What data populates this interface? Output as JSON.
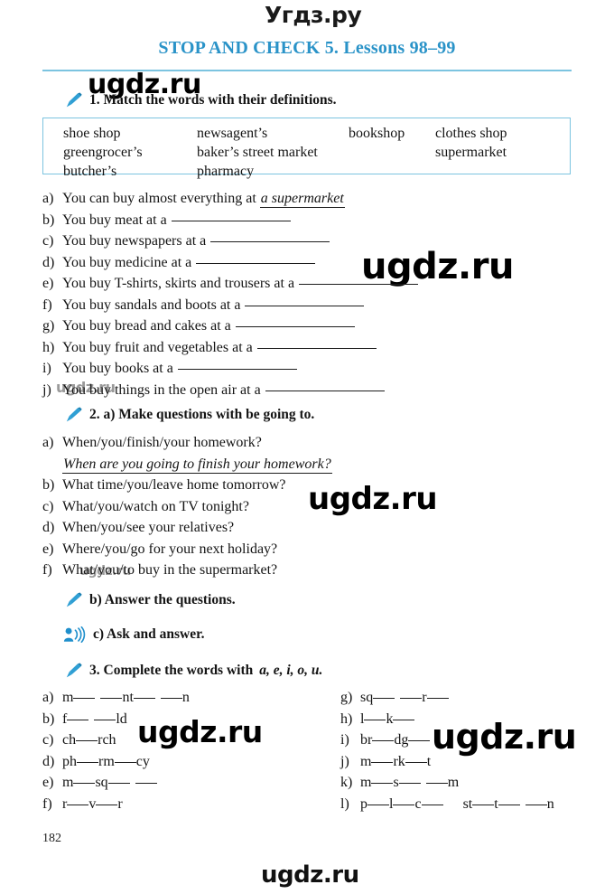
{
  "page": {
    "title": "STOP AND CHECK 5. Lessons 98–99",
    "number": "182",
    "accent_color": "#2a93c8",
    "rule_color": "#7cc4e0"
  },
  "watermarks": {
    "top": "Угдз.ру",
    "brand": "ugdz.ru"
  },
  "exercise1": {
    "heading": "1. Match the words with their definitions.",
    "icon": "pen-icon",
    "wordbank": [
      [
        "shoe shop",
        "newsagent’s",
        "bookshop",
        "clothes shop"
      ],
      [
        "greengrocer’s",
        "baker’s street market",
        "",
        "supermarket"
      ],
      [
        "butcher’s",
        "pharmacy",
        "",
        ""
      ]
    ],
    "items": [
      {
        "marker": "a)",
        "text": "You can buy almost everything at",
        "answer": "a supermarket",
        "blank": 0
      },
      {
        "marker": "b)",
        "text": "You buy meat at a",
        "answer": "",
        "blank": 132
      },
      {
        "marker": "c)",
        "text": "You buy newspapers at a",
        "answer": "",
        "blank": 132
      },
      {
        "marker": "d)",
        "text": "You buy medicine at a",
        "answer": "",
        "blank": 132
      },
      {
        "marker": "e)",
        "text": "You buy T-shirts, skirts and trousers at a",
        "answer": "",
        "blank": 132
      },
      {
        "marker": "f)",
        "text": "You buy sandals and boots at a",
        "answer": "",
        "blank": 132
      },
      {
        "marker": "g)",
        "text": "You buy bread and cakes at a",
        "answer": "",
        "blank": 132
      },
      {
        "marker": "h)",
        "text": "You buy fruit and vegetables at a",
        "answer": "",
        "blank": 132
      },
      {
        "marker": "i)",
        "text": "You buy books at a",
        "answer": "",
        "blank": 132
      },
      {
        "marker": "j)",
        "text": "You buy things in the open air at a",
        "answer": "",
        "blank": 132
      }
    ]
  },
  "exercise2": {
    "heading_a": "2. a) Make questions with be going to.",
    "heading_b": "b) Answer the questions.",
    "heading_c": "c) Ask and answer.",
    "icon_a": "pen-icon",
    "icon_b": "pen-icon",
    "icon_c": "speaking-person-icon",
    "items": [
      {
        "marker": "a)",
        "text": "When/you/finish/your homework?",
        "answer": "When are you going to finish your homework?"
      },
      {
        "marker": "b)",
        "text": "What time/you/leave home tomorrow?",
        "answer": ""
      },
      {
        "marker": "c)",
        "text": "What/you/watch on TV tonight?",
        "answer": ""
      },
      {
        "marker": "d)",
        "text": "When/you/see your relatives?",
        "answer": ""
      },
      {
        "marker": "e)",
        "text": "Where/you/go for your next holiday?",
        "answer": ""
      },
      {
        "marker": "f)",
        "text": "What/you/to buy in the supermarket?",
        "answer": ""
      }
    ]
  },
  "exercise3": {
    "heading_prefix": "3. Complete the words with",
    "heading_letters": "a, e, i, o, u.",
    "icon": "pen-icon",
    "left": [
      {
        "marker": "a)",
        "parts": [
          "m",
          "__",
          " ",
          "__",
          "nt",
          "__",
          " ",
          "__",
          "n"
        ]
      },
      {
        "marker": "b)",
        "parts": [
          "f",
          "__",
          " ",
          "__",
          "ld"
        ]
      },
      {
        "marker": "c)",
        "parts": [
          "ch",
          "__",
          "rch"
        ]
      },
      {
        "marker": "d)",
        "parts": [
          "ph",
          "__",
          "rm",
          "__",
          "cy"
        ]
      },
      {
        "marker": "e)",
        "parts": [
          "m",
          "__",
          "sq",
          "__",
          " ",
          "__"
        ]
      },
      {
        "marker": "f)",
        "parts": [
          "r",
          "__",
          "v",
          "__",
          "r"
        ]
      }
    ],
    "right": [
      {
        "marker": "g)",
        "parts": [
          "sq",
          "__",
          " ",
          "__",
          "r",
          "__"
        ]
      },
      {
        "marker": "h)",
        "parts": [
          "l",
          "__",
          "k",
          "__"
        ]
      },
      {
        "marker": "i)",
        "parts": [
          "br",
          "__",
          "dg",
          "__"
        ]
      },
      {
        "marker": "j)",
        "parts": [
          "m",
          "__",
          "rk",
          "__",
          "t"
        ]
      },
      {
        "marker": "k)",
        "parts": [
          "m",
          "__",
          "s",
          "__",
          " ",
          "__",
          "m"
        ]
      },
      {
        "marker": "l)",
        "parts": [
          "p",
          "__",
          "l",
          "__",
          "c",
          "__",
          "   ",
          "st",
          "__",
          "t",
          "__",
          " ",
          "__",
          "n"
        ]
      }
    ]
  }
}
